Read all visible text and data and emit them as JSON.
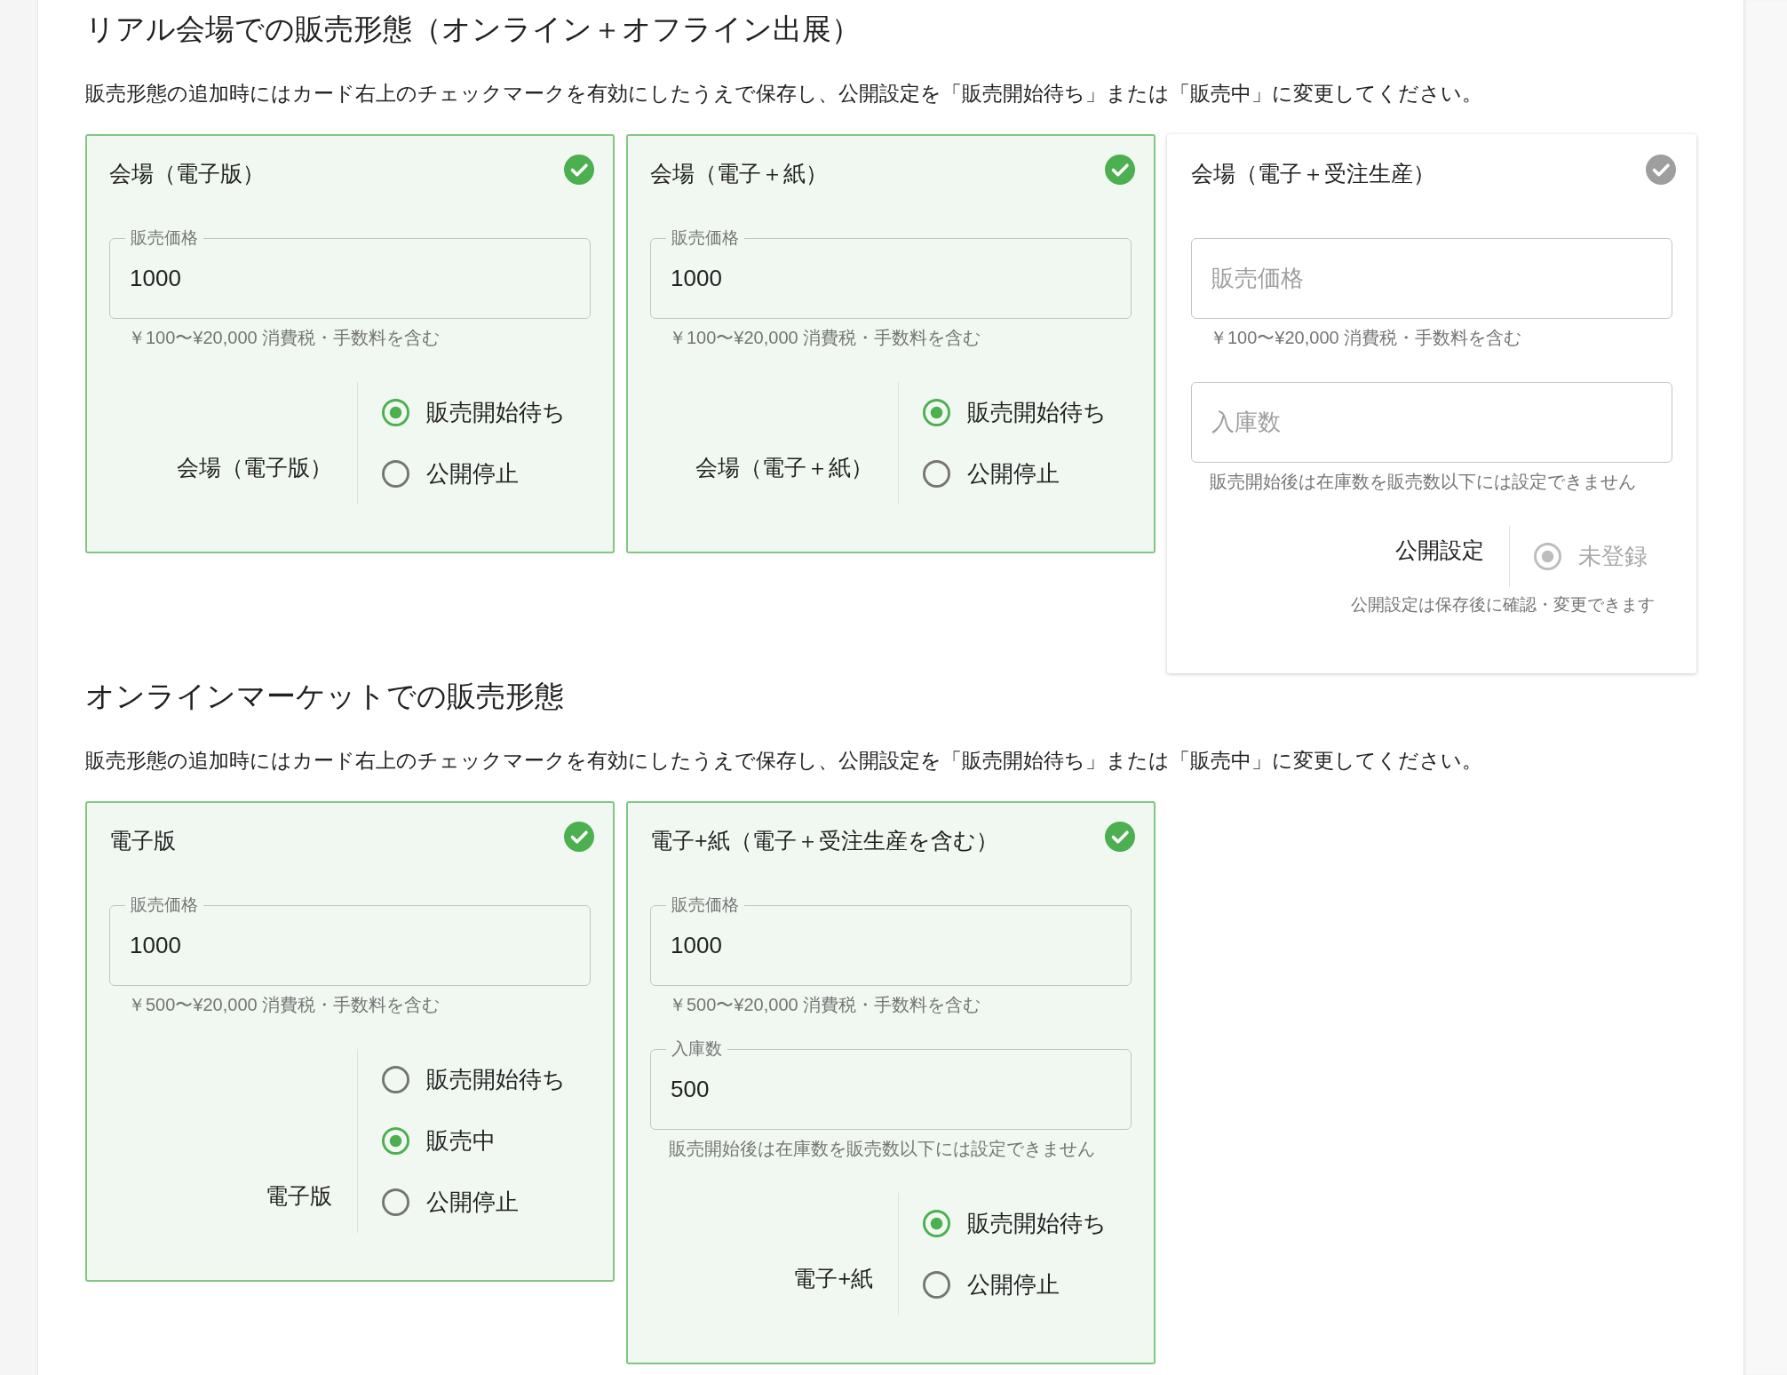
{
  "sections": [
    {
      "title": "リアル会場での販売形態（オンライン＋オフライン出展）",
      "description": "販売形態の追加時にはカード右上のチェックマークを有効にしたうえで保存し、公開設定を「販売開始待ち」または「販売中」に変更してください。",
      "cards": [
        {
          "title": "会場（電子版）",
          "enabled": true,
          "fields": [
            {
              "label": "販売価格",
              "value": "1000",
              "hint": "￥100〜¥20,000 消費税・手数料を含む"
            }
          ],
          "status": {
            "label": "会場（電子版）",
            "disabled": false,
            "options": [
              {
                "label": "販売開始待ち",
                "selected": true
              },
              {
                "label": "公開停止",
                "selected": false
              }
            ]
          }
        },
        {
          "title": "会場（電子＋紙）",
          "enabled": true,
          "fields": [
            {
              "label": "販売価格",
              "value": "1000",
              "hint": "￥100〜¥20,000 消費税・手数料を含む"
            }
          ],
          "status": {
            "label": "会場（電子＋紙）",
            "disabled": false,
            "options": [
              {
                "label": "販売開始待ち",
                "selected": true
              },
              {
                "label": "公開停止",
                "selected": false
              }
            ]
          }
        },
        {
          "title": "会場（電子＋受注生産）",
          "enabled": false,
          "fields": [
            {
              "placeholder": "販売価格",
              "hint": "￥100〜¥20,000 消費税・手数料を含む"
            },
            {
              "placeholder": "入庫数",
              "hint": "販売開始後は在庫数を販売数以下には設定できません"
            }
          ],
          "status": {
            "label": "公開設定",
            "disabled": true,
            "options": [
              {
                "label": "未登録",
                "selected": true
              }
            ],
            "note": "公開設定は保存後に確認・変更できます"
          }
        }
      ]
    },
    {
      "title": "オンラインマーケットでの販売形態",
      "description": "販売形態の追加時にはカード右上のチェックマークを有効にしたうえで保存し、公開設定を「販売開始待ち」または「販売中」に変更してください。",
      "cards": [
        {
          "title": "電子版",
          "enabled": true,
          "fields": [
            {
              "label": "販売価格",
              "value": "1000",
              "hint": "￥500〜¥20,000 消費税・手数料を含む"
            }
          ],
          "status": {
            "label": "電子版",
            "disabled": false,
            "options": [
              {
                "label": "販売開始待ち",
                "selected": false
              },
              {
                "label": "販売中",
                "selected": true
              },
              {
                "label": "公開停止",
                "selected": false
              }
            ]
          }
        },
        {
          "title": "電子+紙（電子＋受注生産を含む）",
          "enabled": true,
          "fields": [
            {
              "label": "販売価格",
              "value": "1000",
              "hint": "￥500〜¥20,000 消費税・手数料を含む"
            },
            {
              "label": "入庫数",
              "value": "500",
              "hint": "販売開始後は在庫数を販売数以下には設定できません"
            }
          ],
          "status": {
            "label": "電子+紙",
            "disabled": false,
            "options": [
              {
                "label": "販売開始待ち",
                "selected": true
              },
              {
                "label": "公開停止",
                "selected": false
              }
            ]
          }
        }
      ]
    }
  ]
}
